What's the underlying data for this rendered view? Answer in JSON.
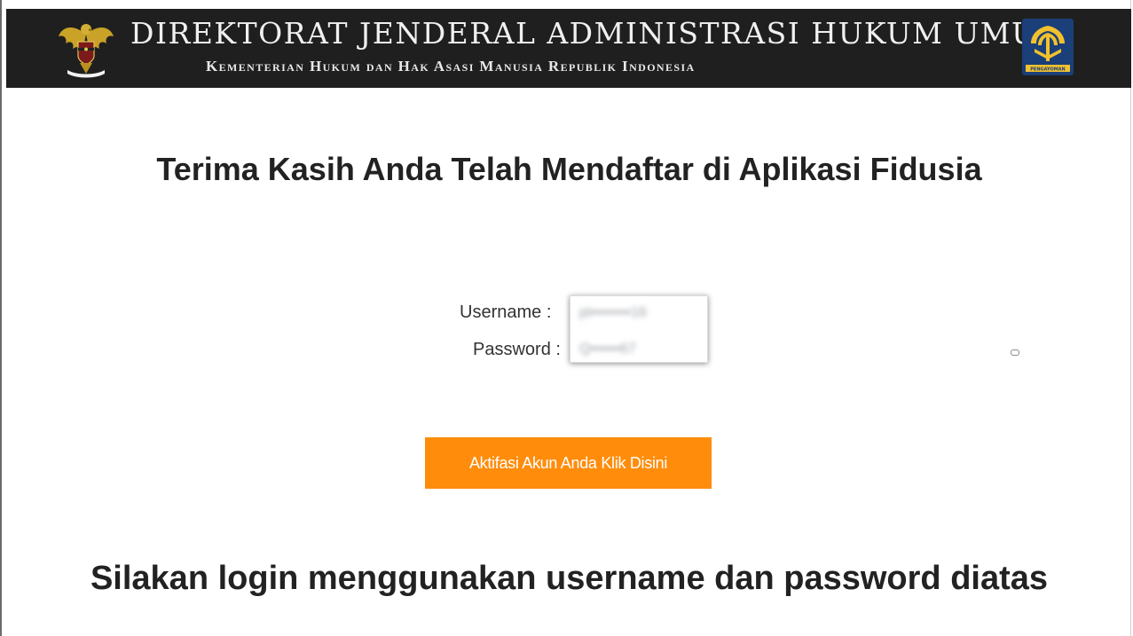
{
  "header": {
    "title": "DIREKTORAT JENDERAL ADMINISTRASI HUKUM UMUM",
    "subtitle": "Kementerian Hukum dan Hak Asasi Manusia Republik Indonesia",
    "left_emblem_icon": "garuda-emblem-icon",
    "right_emblem_icon": "pengayoman-logo-icon",
    "right_emblem_text": "PENGAYOMAN"
  },
  "main": {
    "thanks_heading": "Terima Kasih Anda Telah Mendaftar di Aplikasi Fidusia",
    "credentials": {
      "username_label": "Username :",
      "username_value": "pt••••••••16",
      "password_label": "Password :",
      "password_value": "Q••••••67"
    },
    "activate_button_label": "Aktifasi Akun Anda Klik Disini",
    "login_heading": "Silakan login menggunakan username dan password diatas"
  },
  "colors": {
    "header_background": "#1f1f1f",
    "button_background": "#ff8c0a",
    "heading_text": "#222222"
  }
}
